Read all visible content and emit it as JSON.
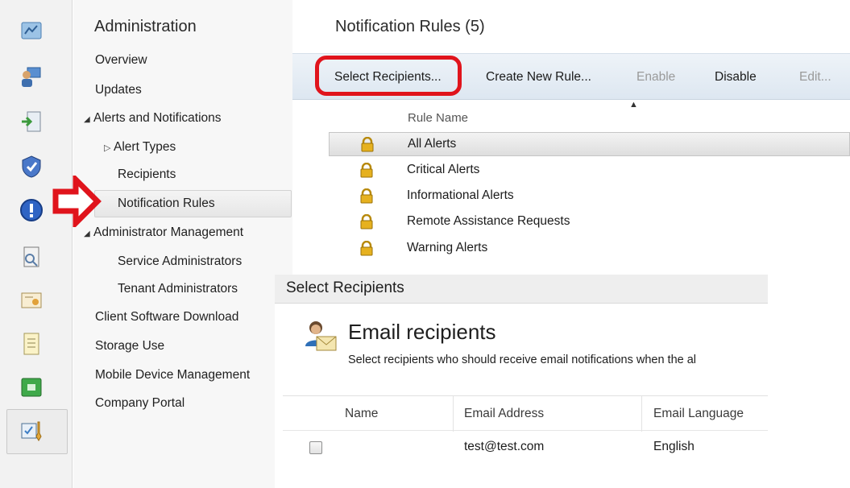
{
  "nav": {
    "title": "Administration",
    "items": [
      {
        "label": "Overview"
      },
      {
        "label": "Updates"
      },
      {
        "label": "Alerts and Notifications"
      },
      {
        "label": "Alert Types"
      },
      {
        "label": "Recipients"
      },
      {
        "label": "Notification Rules"
      },
      {
        "label": "Administrator Management"
      },
      {
        "label": "Service Administrators"
      },
      {
        "label": "Tenant Administrators"
      },
      {
        "label": "Client Software Download"
      },
      {
        "label": "Storage Use"
      },
      {
        "label": "Mobile Device Management"
      },
      {
        "label": "Company Portal"
      }
    ]
  },
  "main": {
    "title": "Notification Rules (5)",
    "toolbar": {
      "select_recipients": "Select Recipients...",
      "create_new_rule": "Create New Rule...",
      "enable": "Enable",
      "disable": "Disable",
      "edit": "Edit..."
    },
    "column_header": "Rule Name",
    "rules": [
      {
        "name": "All Alerts"
      },
      {
        "name": "Critical Alerts"
      },
      {
        "name": "Informational Alerts"
      },
      {
        "name": "Remote Assistance Requests"
      },
      {
        "name": "Warning Alerts"
      }
    ]
  },
  "dialog": {
    "title": "Select Recipients",
    "heading": "Email recipients",
    "subtitle": "Select recipients who should receive email notifications when the al",
    "columns": {
      "name": "Name",
      "email": "Email Address",
      "language": "Email Language"
    },
    "rows": [
      {
        "name": "",
        "email": "test@test.com",
        "language": "English",
        "checked": false
      }
    ]
  },
  "rail_icons": [
    "overview-icon",
    "groups-icon",
    "software-icon",
    "policy-icon",
    "alerts-icon",
    "reports-icon",
    "licenses-icon",
    "notes-icon",
    "storage-icon",
    "administration-icon"
  ],
  "colors": {
    "highlight_red": "#e0141c",
    "toolbar_blue": "#dde7f1"
  }
}
